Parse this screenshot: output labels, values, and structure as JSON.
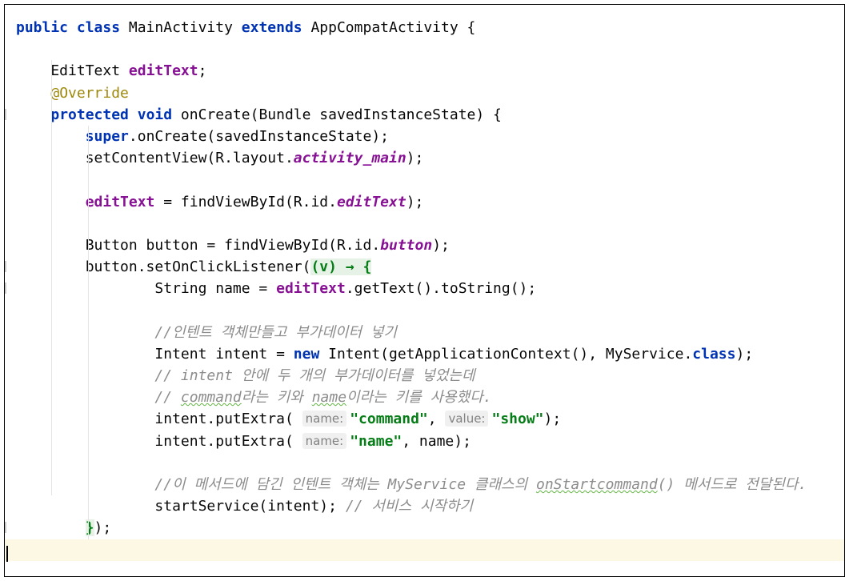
{
  "editor": {
    "language": "Java",
    "lines": [
      [
        {
          "t": "public class",
          "c": "kw"
        },
        {
          "t": " MainActivity "
        },
        {
          "t": "extends",
          "c": "kw"
        },
        {
          "t": " AppCompatActivity {"
        }
      ],
      [],
      [
        {
          "t": "    EditText "
        },
        {
          "t": "editText",
          "c": "fld"
        },
        {
          "t": ";"
        }
      ],
      [
        {
          "t": "    "
        },
        {
          "t": "@Override",
          "c": "ann"
        }
      ],
      [
        {
          "t": "    "
        },
        {
          "t": "protected void",
          "c": "kw"
        },
        {
          "t": " onCreate(Bundle savedInstanceState) {"
        }
      ],
      [
        {
          "t": "        "
        },
        {
          "t": "super",
          "c": "kw"
        },
        {
          "t": ".onCreate(savedInstanceState);"
        }
      ],
      [
        {
          "t": "        setContentView(R.layout."
        },
        {
          "t": "activity_main",
          "c": "fld-it"
        },
        {
          "t": ");"
        }
      ],
      [],
      [
        {
          "t": "        "
        },
        {
          "t": "editText",
          "c": "fld"
        },
        {
          "t": " = findViewById(R.id."
        },
        {
          "t": "editText",
          "c": "fld-it"
        },
        {
          "t": ");"
        }
      ],
      [],
      [
        {
          "t": "        Button button = findViewById(R.id."
        },
        {
          "t": "button",
          "c": "fld-it"
        },
        {
          "t": ");"
        }
      ],
      [
        {
          "t": "        button.setOnClickListener("
        },
        {
          "t": "(v) → {",
          "c": "lam"
        }
      ],
      [
        {
          "t": "                String name = "
        },
        {
          "t": "editText",
          "c": "fld"
        },
        {
          "t": ".getText().toString();"
        }
      ],
      [],
      [
        {
          "t": "                "
        },
        {
          "t": "//인텐트 객체만들고 부가데이터 넣기",
          "c": "cmt"
        }
      ],
      [
        {
          "t": "                Intent intent = "
        },
        {
          "t": "new",
          "c": "kw"
        },
        {
          "t": " Intent(getApplicationContext(), MyService."
        },
        {
          "t": "class",
          "c": "kw"
        },
        {
          "t": ");"
        }
      ],
      [
        {
          "t": "                "
        },
        {
          "t": "// intent 안에 두 개의 부가데이터를 넣었는데",
          "c": "cmt"
        }
      ],
      [
        {
          "t": "                "
        },
        {
          "t": "// ",
          "c": "cmt"
        },
        {
          "t": "command",
          "c": "cmt",
          "w": true
        },
        {
          "t": "라는 키와 ",
          "c": "cmt"
        },
        {
          "t": "name",
          "c": "cmt",
          "w": true
        },
        {
          "t": "이라는 키를 사용했다.",
          "c": "cmt"
        }
      ],
      [
        {
          "t": "                intent.putExtra( "
        },
        {
          "t": "name:",
          "c": "hint"
        },
        {
          "t": "\"command\"",
          "c": "str"
        },
        {
          "t": ", "
        },
        {
          "t": "value:",
          "c": "hint"
        },
        {
          "t": "\"show\"",
          "c": "str"
        },
        {
          "t": ");"
        }
      ],
      [
        {
          "t": "                intent.putExtra( "
        },
        {
          "t": "name:",
          "c": "hint"
        },
        {
          "t": "\"name\"",
          "c": "str"
        },
        {
          "t": ", name);"
        }
      ],
      [],
      [
        {
          "t": "                "
        },
        {
          "t": "//이 메서드에 담긴 인텐트 객체는 MyService 클래스의 ",
          "c": "cmt"
        },
        {
          "t": "onStartcommand",
          "c": "cmt",
          "w": true
        },
        {
          "t": "() 메서드로 전달된다.",
          "c": "cmt"
        }
      ],
      [
        {
          "t": "                startService(intent); "
        },
        {
          "t": "// 서비스 시작하기",
          "c": "cmt"
        }
      ],
      [
        {
          "t": "        "
        },
        {
          "t": "}",
          "c": "lam"
        },
        {
          "t": ");"
        }
      ],
      []
    ]
  }
}
